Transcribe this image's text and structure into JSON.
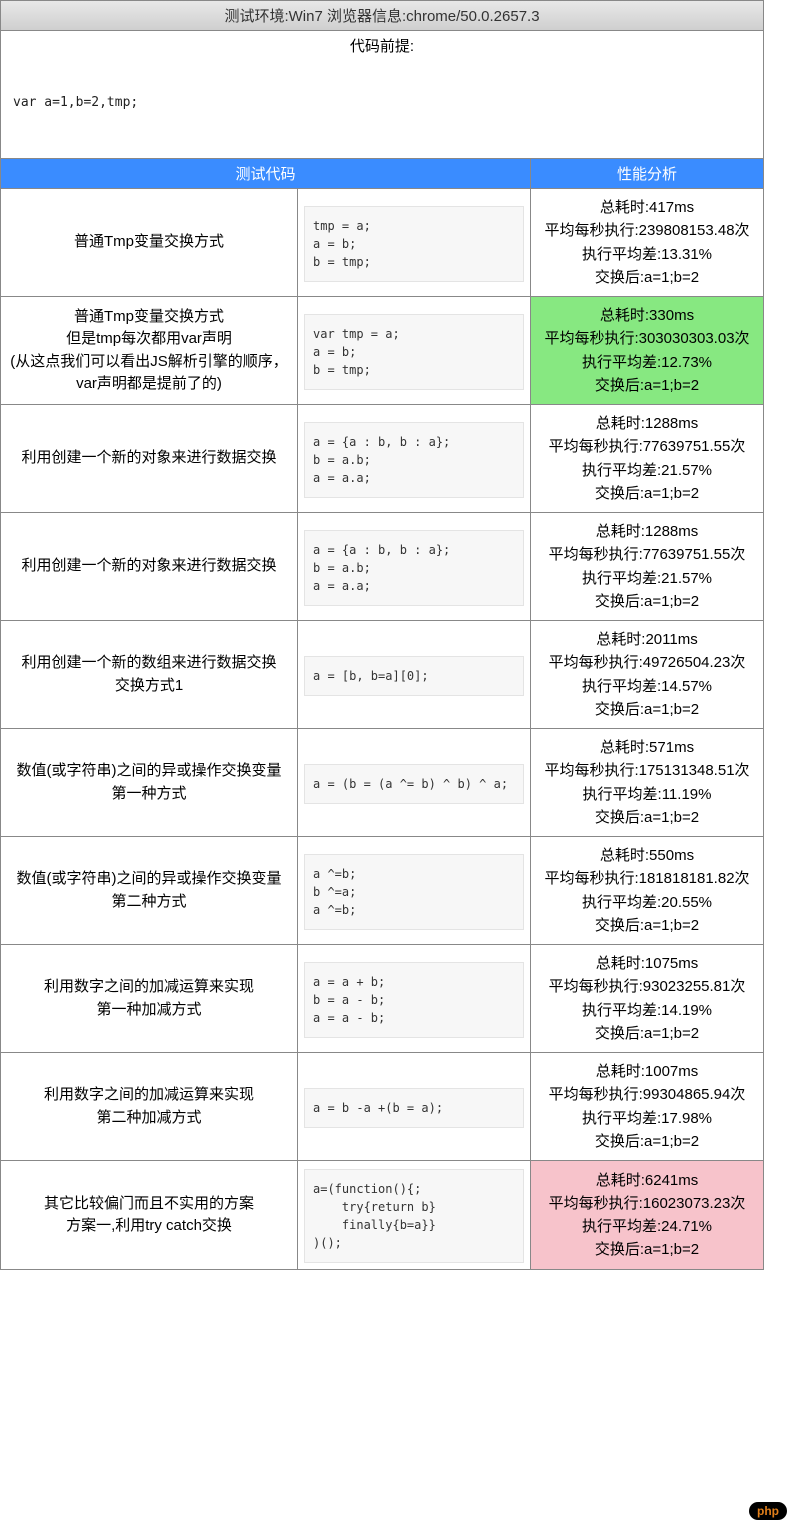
{
  "env_bar": "测试环境:Win7    浏览器信息:chrome/50.0.2657.3",
  "premise_label": "代码前提:",
  "premise_code": "var a=1,b=2,tmp;",
  "headers": {
    "code": "测试代码",
    "perf": "性能分析"
  },
  "rows": [
    {
      "name": "普通Tmp变量交换方式",
      "code": "tmp = a;\na = b;\nb = tmp;",
      "perf": {
        "total": "总耗时:417ms",
        "per_sec": "平均每秒执行:239808153.48次",
        "avg_diff": "执行平均差:13.31%",
        "after": "交换后:a=1;b=2"
      },
      "hl": ""
    },
    {
      "name": "普通Tmp变量交换方式\n但是tmp每次都用var声明\n(从这点我们可以看出JS解析引擎的顺序，var声明都是提前了的)",
      "code": "var tmp = a;\na = b;\nb = tmp;",
      "perf": {
        "total": "总耗时:330ms",
        "per_sec": "平均每秒执行:303030303.03次",
        "avg_diff": "执行平均差:12.73%",
        "after": "交换后:a=1;b=2"
      },
      "hl": "green"
    },
    {
      "name": "利用创建一个新的对象来进行数据交换",
      "code": "a = {a : b, b : a};\nb = a.b;\na = a.a;",
      "perf": {
        "total": "总耗时:1288ms",
        "per_sec": "平均每秒执行:77639751.55次",
        "avg_diff": "执行平均差:21.57%",
        "after": "交换后:a=1;b=2"
      },
      "hl": ""
    },
    {
      "name": "利用创建一个新的对象来进行数据交换",
      "code": "a = {a : b, b : a};\nb = a.b;\na = a.a;",
      "perf": {
        "total": "总耗时:1288ms",
        "per_sec": "平均每秒执行:77639751.55次",
        "avg_diff": "执行平均差:21.57%",
        "after": "交换后:a=1;b=2"
      },
      "hl": ""
    },
    {
      "name": "利用创建一个新的数组来进行数据交换\n交换方式1",
      "code": "a = [b, b=a][0];",
      "perf": {
        "total": "总耗时:2011ms",
        "per_sec": "平均每秒执行:49726504.23次",
        "avg_diff": "执行平均差:14.57%",
        "after": "交换后:a=1;b=2"
      },
      "hl": ""
    },
    {
      "name": "数值(或字符串)之间的异或操作交换变量\n第一种方式",
      "code": "a = (b = (a ^= b) ^ b) ^ a;",
      "perf": {
        "total": "总耗时:571ms",
        "per_sec": "平均每秒执行:175131348.51次",
        "avg_diff": "执行平均差:11.19%",
        "after": "交换后:a=1;b=2"
      },
      "hl": ""
    },
    {
      "name": "数值(或字符串)之间的异或操作交换变量\n第二种方式",
      "code": "a ^=b;\nb ^=a;\na ^=b;",
      "perf": {
        "total": "总耗时:550ms",
        "per_sec": "平均每秒执行:181818181.82次",
        "avg_diff": "执行平均差:20.55%",
        "after": "交换后:a=1;b=2"
      },
      "hl": ""
    },
    {
      "name": "利用数字之间的加减运算来实现\n第一种加减方式",
      "code": "a = a + b;\nb = a - b;\na = a - b;",
      "perf": {
        "total": "总耗时:1075ms",
        "per_sec": "平均每秒执行:93023255.81次",
        "avg_diff": "执行平均差:14.19%",
        "after": "交换后:a=1;b=2"
      },
      "hl": ""
    },
    {
      "name": "利用数字之间的加减运算来实现\n第二种加减方式",
      "code": "a = b -a +(b = a);",
      "perf": {
        "total": "总耗时:1007ms",
        "per_sec": "平均每秒执行:99304865.94次",
        "avg_diff": "执行平均差:17.98%",
        "after": "交换后:a=1;b=2"
      },
      "hl": ""
    },
    {
      "name": "其它比较偏门而且不实用的方案\n方案一,利用try catch交换",
      "code": "a=(function(){;\n    try{return b}\n    finally{b=a}}\n)();",
      "perf": {
        "total": "总耗时:6241ms",
        "per_sec": "平均每秒执行:16023073.23次",
        "avg_diff": "执行平均差:24.71%",
        "after": "交换后:a=1;b=2"
      },
      "hl": "pink"
    }
  ],
  "badge": "php"
}
